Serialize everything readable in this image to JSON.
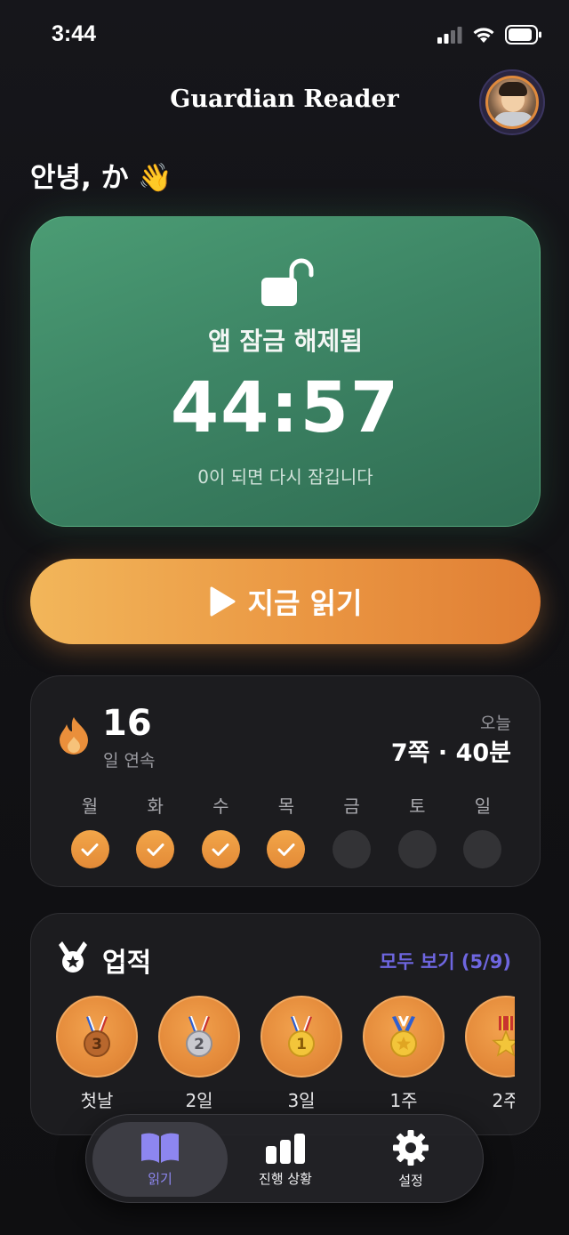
{
  "status_bar": {
    "time": "3:44"
  },
  "header": {
    "title": "Guardian Reader"
  },
  "greeting": "안녕, か 👋",
  "unlock_card": {
    "label": "앱 잠금 해제됨",
    "timer": "44:57",
    "subtitle": "0이 되면 다시 잠깁니다"
  },
  "read_button": {
    "label": "지금 읽기"
  },
  "streak": {
    "count": "16",
    "unit": "일 연속",
    "today_label": "오늘",
    "today_value": "7쪽 · 40분",
    "days": [
      {
        "label": "월",
        "done": true
      },
      {
        "label": "화",
        "done": true
      },
      {
        "label": "수",
        "done": true
      },
      {
        "label": "목",
        "done": true
      },
      {
        "label": "금",
        "done": false
      },
      {
        "label": "토",
        "done": false
      },
      {
        "label": "일",
        "done": false
      }
    ]
  },
  "achievements": {
    "title": "업적",
    "see_all": "모두 보기 (5/9)",
    "items": [
      {
        "label": "첫날",
        "medal": "bronze-medal-3"
      },
      {
        "label": "2일",
        "medal": "silver-medal-2"
      },
      {
        "label": "3일",
        "medal": "gold-medal-1"
      },
      {
        "label": "1주",
        "medal": "sports-medal"
      },
      {
        "label": "2주",
        "medal": "military-medal"
      }
    ]
  },
  "tab_bar": {
    "tabs": [
      {
        "label": "읽기",
        "icon": "book-icon",
        "active": true
      },
      {
        "label": "진행 상황",
        "icon": "bar-chart-icon",
        "active": false
      },
      {
        "label": "설정",
        "icon": "gear-icon",
        "active": false
      }
    ]
  },
  "colors": {
    "accent": "#8d86f0",
    "link": "#6e66e0",
    "orange": "#e8903c",
    "card_green": "#3d8565"
  }
}
